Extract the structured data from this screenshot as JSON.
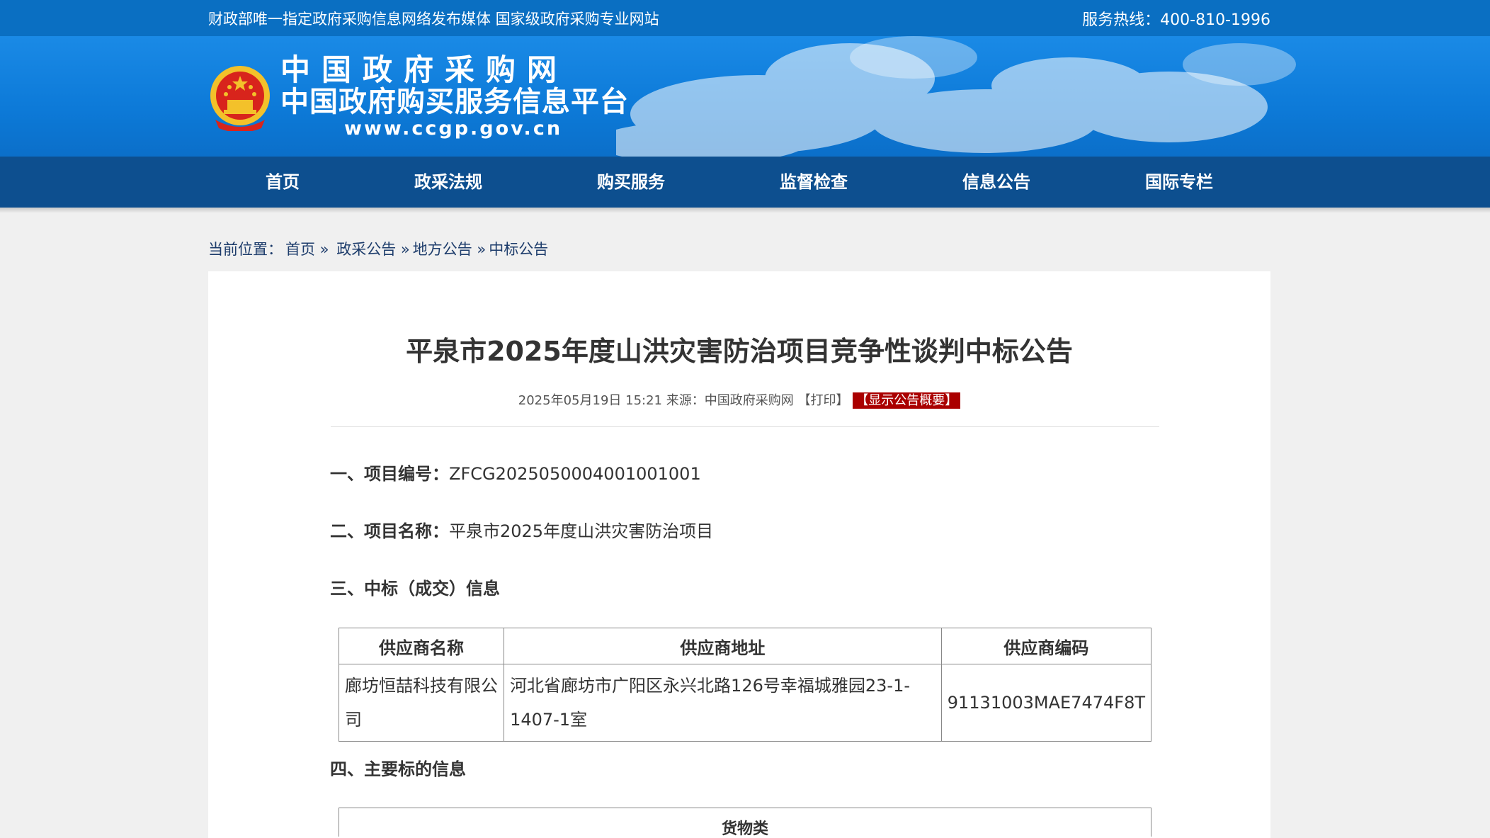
{
  "topbar": {
    "slogan": "财政部唯一指定政府采购信息网络发布媒体 国家级政府采购专业网站",
    "hotline": "服务热线：400-810-1996"
  },
  "logo": {
    "line1": "中国政府采购网",
    "line2": "中国政府购买服务信息平台",
    "line3": "www.ccgp.gov.cn"
  },
  "nav": [
    "首页",
    "政采法规",
    "购买服务",
    "监督检查",
    "信息公告",
    "国际专栏"
  ],
  "breadcrumb": {
    "prefix": "当前位置：",
    "items": [
      "首页 »",
      "政采公告 »",
      "地方公告 »",
      "中标公告"
    ]
  },
  "article": {
    "title": "平泉市2025年度山洪灾害防治项目竞争性谈判中标公告",
    "date": "2025年05月19日 15:21",
    "source": "来源：中国政府采购网",
    "print": "【打印】",
    "summary": "【显示公告概要】",
    "s1_label": "一、项目编号：",
    "s1_value": "ZFCG2025050004001001001",
    "s2_label": "二、项目名称：",
    "s2_value": "平泉市2025年度山洪灾害防治项目",
    "s3_label": "三、中标（成交）信息",
    "s4_label": "四、主要标的信息",
    "table": {
      "headers": [
        "供应商名称",
        "供应商地址",
        "供应商编码"
      ],
      "row": [
        "廊坊恒喆科技有限公司",
        "河北省廊坊市广阳区永兴北路126号幸福城雅园23-1-1407-1室",
        "91131003MAE7474F8T"
      ]
    },
    "table2_header": "货物类"
  }
}
